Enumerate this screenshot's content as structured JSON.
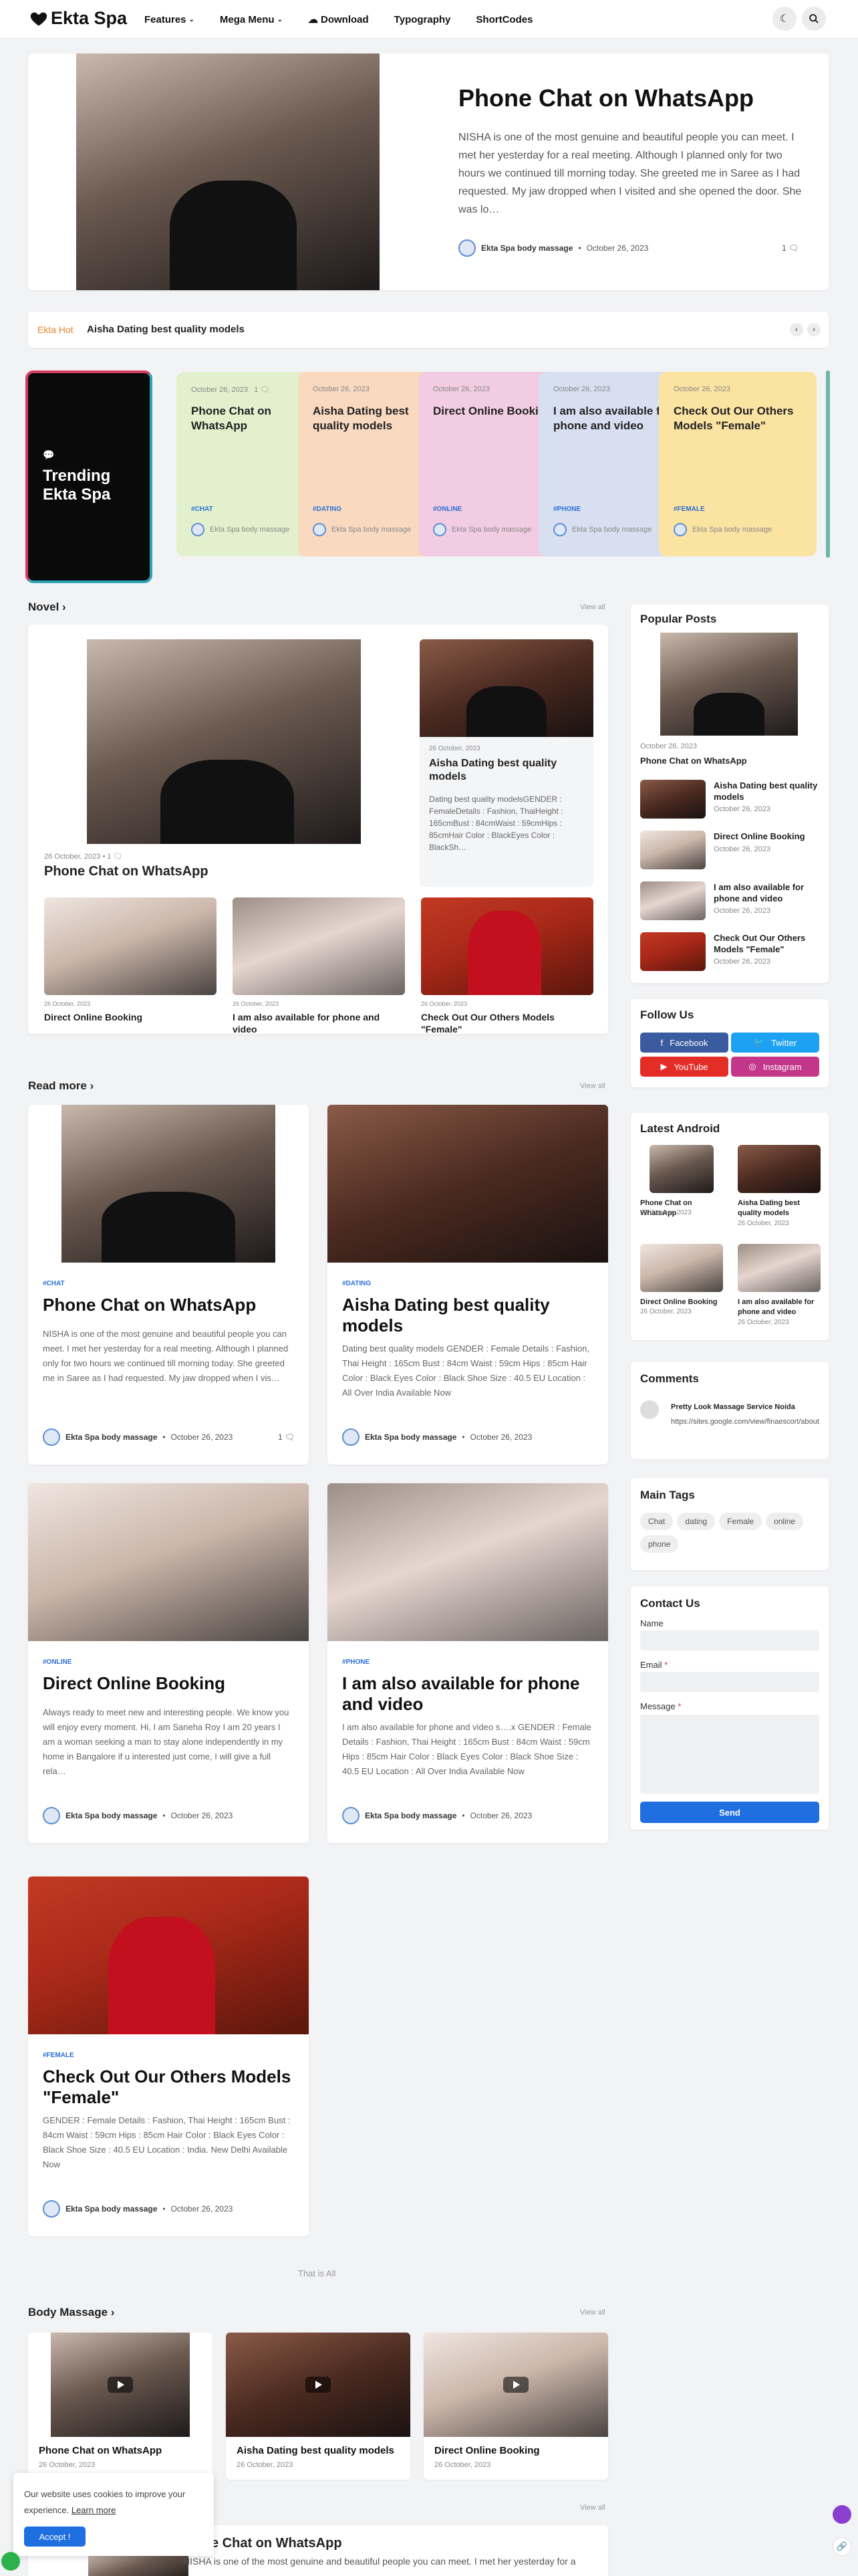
{
  "header": {
    "logo": "Ekta Spa",
    "nav": [
      "Features",
      "Mega Menu",
      "Download",
      "Typography",
      "ShortCodes"
    ]
  },
  "hero": {
    "title": "Phone Chat on WhatsApp",
    "excerpt": "NISHA is one of the most genuine and beautiful people you can meet.  I met her yesterday for a real meeting. Although I planned only for two hours we continued till morning today. She greeted me in Saree as I had requested. My jaw dropped when I visited and she opened the door. She was lo…",
    "author": "Ekta Spa body massage",
    "date": "October 26, 2023",
    "comments": "1"
  },
  "ticker": {
    "label": "Ekta Hot",
    "text": "Aisha Dating best quality models"
  },
  "trending": {
    "label_line1": "Trending",
    "label_line2": "Ekta Spa",
    "cards": [
      {
        "date": "October 26, 2023",
        "comments": "1",
        "title": "Phone Chat on WhatsApp",
        "tag": "#CHAT",
        "author": "Ekta Spa body massage",
        "color": "#e2f0cd"
      },
      {
        "date": "October 26, 2023",
        "title": "Aisha Dating best quality models",
        "tag": "#DATING",
        "author": "Ekta Spa body massage",
        "color": "#f9d9c0"
      },
      {
        "date": "October 26, 2023",
        "title": "Direct Online Booking",
        "tag": "#ONLINE",
        "author": "Ekta Spa body massage",
        "color": "#f2cce2"
      },
      {
        "date": "October 26, 2023",
        "title": "I am also available for phone and video",
        "tag": "#PHONE",
        "author": "Ekta Spa body massage",
        "color": "#d7dff0"
      },
      {
        "date": "October 26, 2023",
        "title": "Check Out Our Others Models \"Female\"",
        "tag": "#FEMALE",
        "author": "Ekta Spa body massage",
        "color": "#fbe3a2"
      }
    ]
  },
  "novel": {
    "title": "Novel",
    "view_all": "View all",
    "main": {
      "date": "26 October, 2023",
      "comments": "1",
      "title": "Phone Chat on WhatsApp"
    },
    "side": {
      "date": "26 October, 2023",
      "title": "Aisha Dating best quality models",
      "excerpt": "Dating best quality modelsGENDER : FemaleDetails : Fashion, ThaiHeight : 165cmBust : 84cmWaist : 59cmHips : 85cmHair Color : BlackEyes Color : BlackSh…"
    },
    "grid": [
      {
        "date": "26 October, 2023",
        "title": "Direct Online Booking"
      },
      {
        "date": "26 October, 2023",
        "title": "I am also available for phone and video"
      },
      {
        "date": "26 October, 2023",
        "title": "Check Out Our Others Models \"Female\""
      }
    ]
  },
  "readmore": {
    "title": "Read more",
    "view_all": "View all",
    "posts": [
      {
        "tag": "#CHAT",
        "title": "Phone Chat on WhatsApp",
        "excerpt": "NISHA is one of the most genuine and beautiful people you can meet.  I met her yesterday for a real meeting. Although I planned only for two hours we continued till morning today. She greeted me in Saree as I had requested. My jaw dropped when I vis…",
        "author": "Ekta Spa body massage",
        "date": "October 26, 2023",
        "comments": "1"
      },
      {
        "tag": "#DATING",
        "title": "Aisha Dating best quality models",
        "excerpt": "Dating best quality models GENDER : Female Details : Fashion, Thai Height : 165cm Bust : 84cm Waist : 59cm Hips : 85cm Hair Color : Black Eyes Color : Black Shoe Size : 40.5 EU Location : All Over India Available Now",
        "author": "Ekta Spa body massage",
        "date": "October 26, 2023"
      },
      {
        "tag": "#ONLINE",
        "title": "Direct Online Booking",
        "excerpt": "Always ready to meet new and interesting people. We know you will enjoy every moment. Hi, I am Saneha Roy I am 20 years I am a woman seeking a man to stay alone independently in my home in Bangalore if u interested just come, I will give a full rela…",
        "author": "Ekta Spa body massage",
        "date": "October 26, 2023"
      },
      {
        "tag": "#PHONE",
        "title": "I am also available for phone and video",
        "excerpt": "I am also available for phone and video s….x  GENDER : Female Details : Fashion, Thai Height : 165cm Bust : 84cm Waist : 59cm Hips : 85cm Hair Color : Black Eyes Color : Black Shoe Size : 40.5 EU Location : All Over India Available Now",
        "author": "Ekta Spa body massage",
        "date": "October 26, 2023"
      },
      {
        "tag": "#FEMALE",
        "title": "Check Out Our Others Models \"Female\"",
        "excerpt": "GENDER : Female  Details : Fashion, Thai  Height : 165cm  Bust : 84cm  Waist : 59cm  Hips : 85cm  Hair Color : Black  Eyes Color : Black  Shoe Size : 40.5 EU  Location : India.  New Delhi  Available Now",
        "author": "Ekta Spa body massage",
        "date": "October 26, 2023"
      }
    ],
    "end": "That is All"
  },
  "body_massage": {
    "title": "Body Massage",
    "view_all": "View all",
    "items": [
      {
        "title": "Phone Chat on WhatsApp",
        "date": "26 October, 2023"
      },
      {
        "title": "Aisha Dating best quality models",
        "date": "26 October, 2023"
      },
      {
        "title": "Direct Online Booking",
        "date": "26 October, 2023"
      }
    ]
  },
  "bottom": {
    "view_all": "View all",
    "title": "Phone Chat on WhatsApp",
    "excerpt": "NISHA is one of the most genuine and beautiful people you can meet. I met her yesterday for a"
  },
  "cookie": {
    "text": "Our website uses cookies to improve your experience.",
    "link": "Learn more",
    "button": "Accept !"
  },
  "sidebar": {
    "popular": {
      "title": "Popular Posts",
      "top": {
        "date": "October 26, 2023",
        "title": "Phone Chat on WhatsApp"
      },
      "list": [
        {
          "title": "Aisha Dating best quality models",
          "date": "October 26, 2023"
        },
        {
          "title": "Direct Online Booking",
          "date": "October 26, 2023"
        },
        {
          "title": "I am also available for phone and video",
          "date": "October 26, 2023"
        },
        {
          "title": "Check Out Our Others Models \"Female\"",
          "date": "October 26, 2023"
        }
      ]
    },
    "follow": {
      "title": "Follow Us",
      "facebook": "Facebook",
      "twitter": "Twitter",
      "youtube": "YouTube",
      "instagram": "Instagram"
    },
    "android": {
      "title": "Latest Android",
      "items": [
        {
          "title": "Phone Chat on WhatsApp",
          "date": "26 October, 2023"
        },
        {
          "title": "Aisha Dating best quality models",
          "date": "26 October, 2023"
        },
        {
          "title": "Direct Online Booking",
          "date": "26 October, 2023"
        },
        {
          "title": "I am also available for phone and video",
          "date": "26 October, 2023"
        }
      ]
    },
    "comments": {
      "title": "Comments",
      "name": "Pretty Look Massage Service Noida",
      "text": "https://sites.google.com/view/finaescort/about"
    },
    "tags": {
      "title": "Main Tags",
      "items": [
        "Chat",
        "dating",
        "Female",
        "online",
        "phone"
      ]
    },
    "contact": {
      "title": "Contact Us",
      "name": "Name",
      "email": "Email",
      "message": "Message",
      "required": "*",
      "send": "Send"
    }
  }
}
